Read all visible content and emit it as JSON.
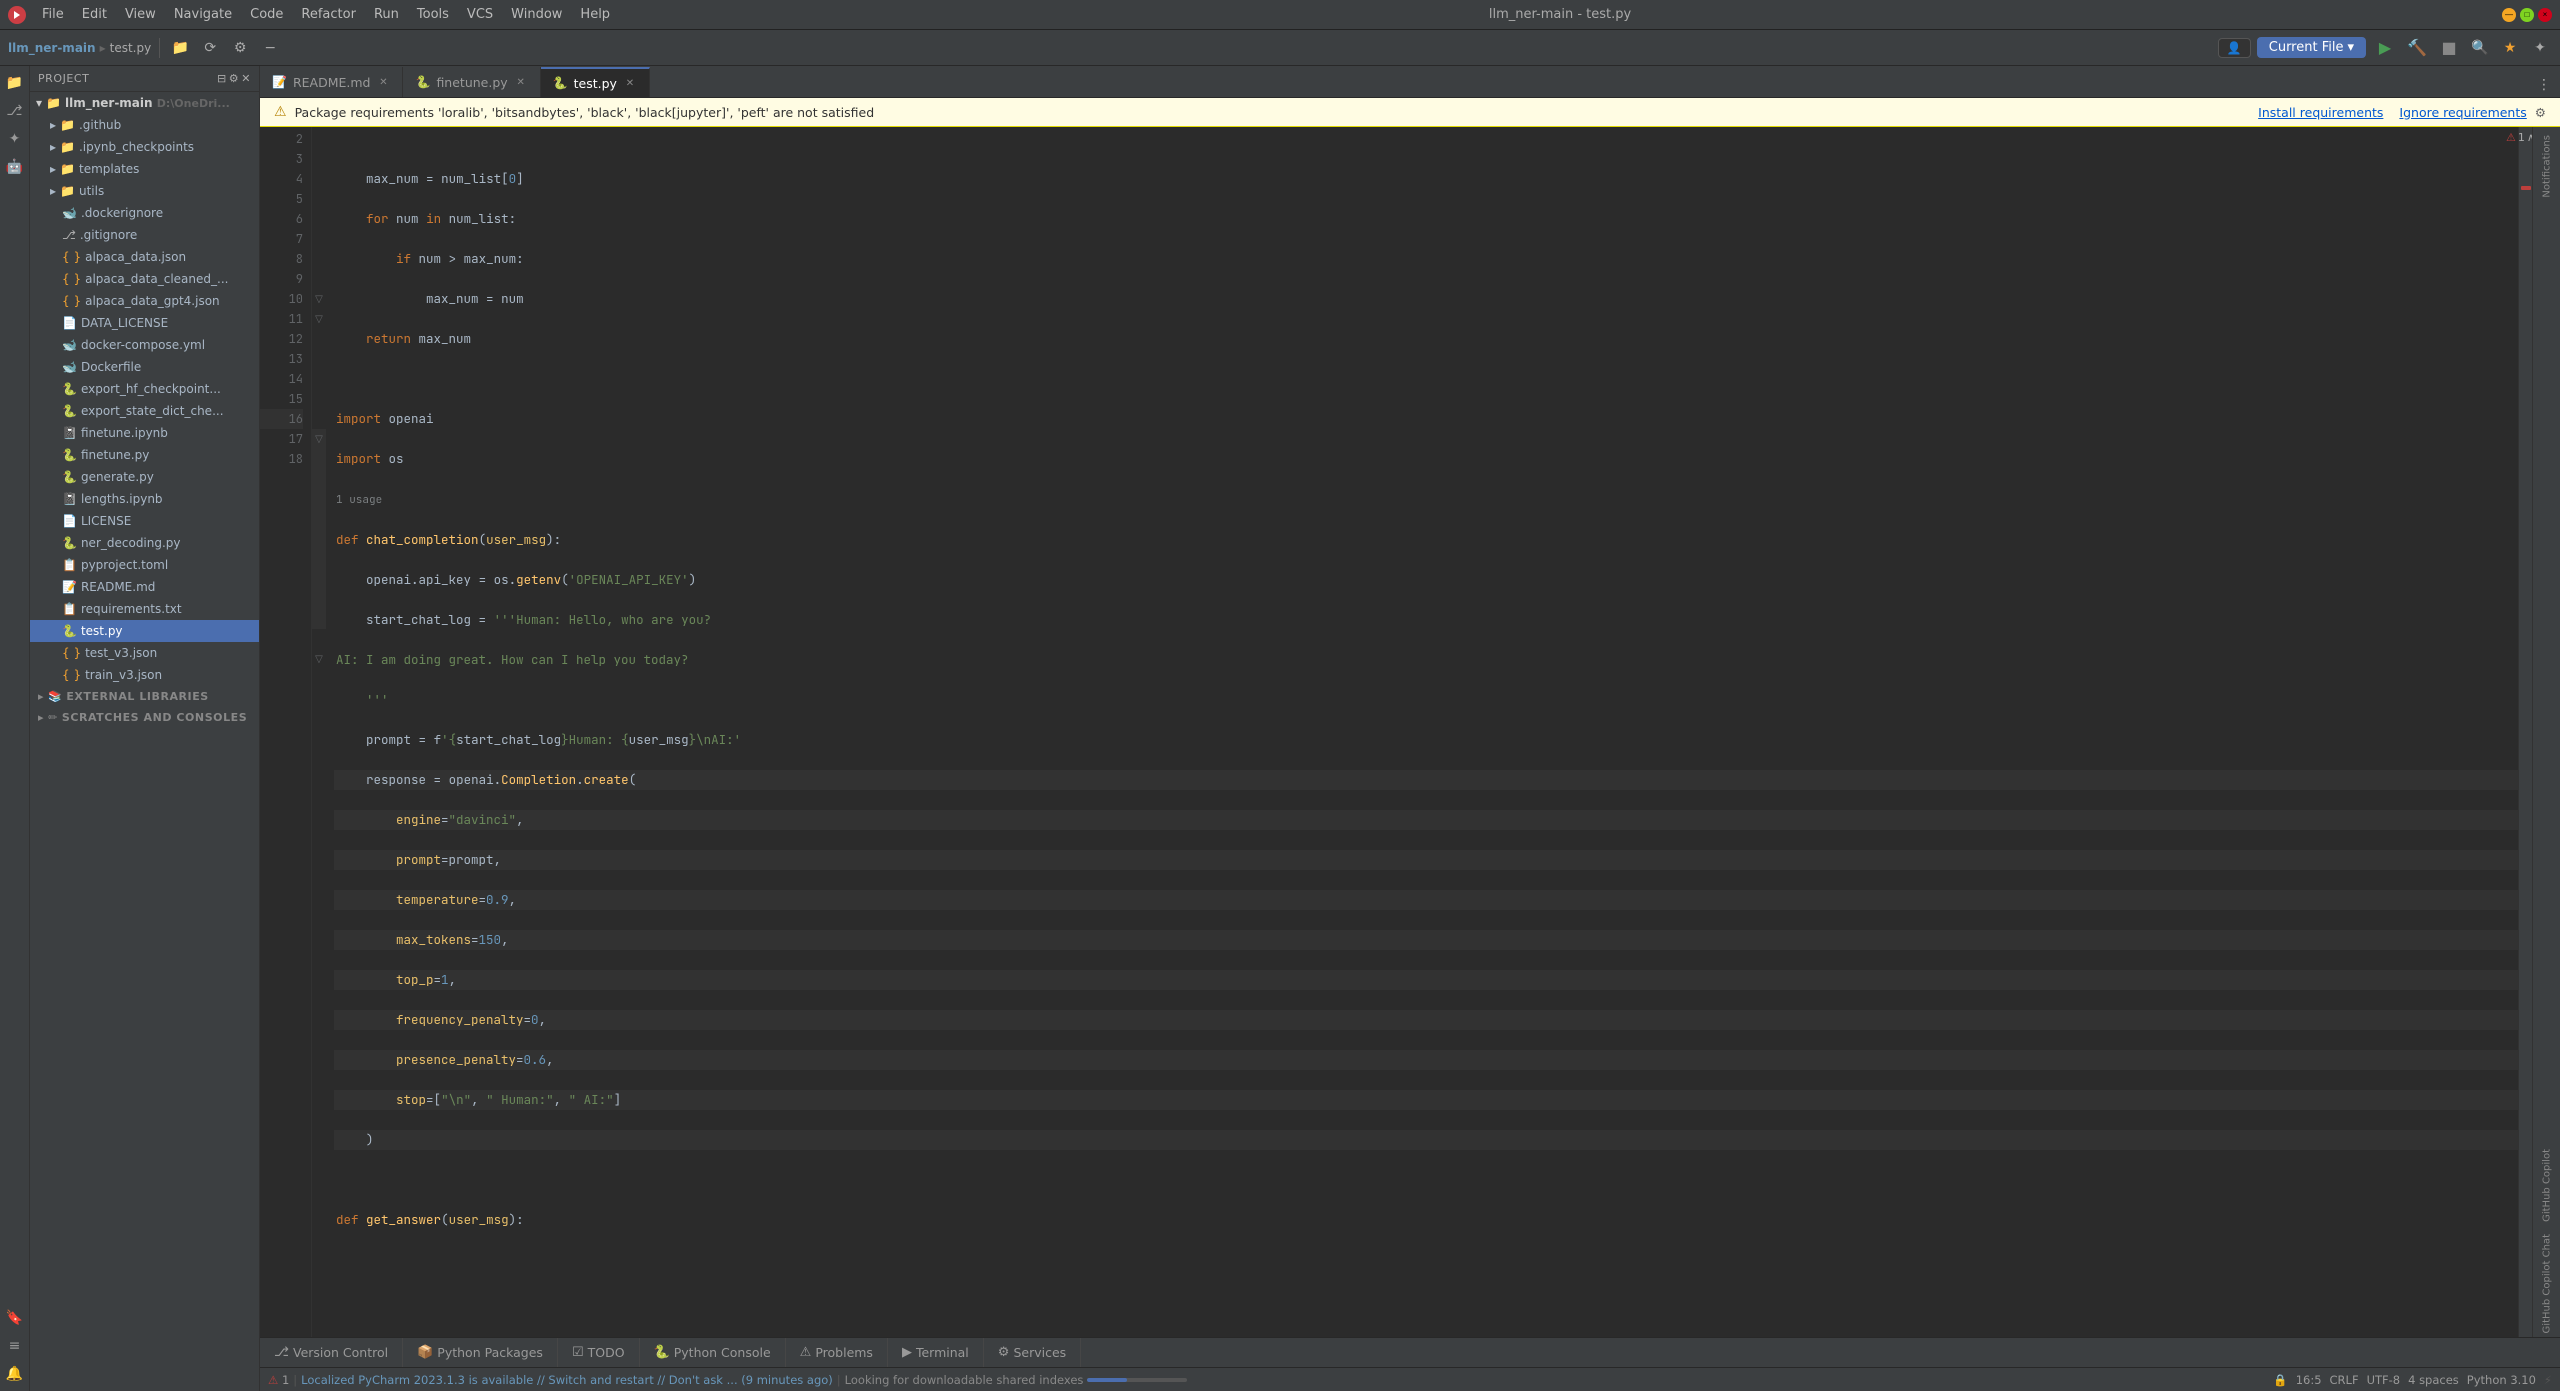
{
  "titlebar": {
    "logo": "P",
    "menus": [
      "File",
      "Edit",
      "View",
      "Navigate",
      "Code",
      "Refactor",
      "Run",
      "Tools",
      "VCS",
      "Window",
      "Help"
    ],
    "title": "llm_ner-main - test.py",
    "project_name": "llm_ner-main"
  },
  "toolbar": {
    "current_file_label": "Current File",
    "run_label": "▶",
    "stop_label": "■",
    "search_label": "🔍",
    "settings_label": "⚙"
  },
  "tabs": [
    {
      "id": "readme",
      "label": "README.md",
      "icon": "md",
      "active": false,
      "closeable": true
    },
    {
      "id": "finetune",
      "label": "finetune.py",
      "icon": "py",
      "active": false,
      "closeable": true
    },
    {
      "id": "test",
      "label": "test.py",
      "icon": "py",
      "active": true,
      "closeable": true
    }
  ],
  "warning_banner": {
    "text": "Package requirements 'loralib', 'bitsandbytes', 'black', 'black[jupyter]', 'peft' are not satisfied",
    "install_label": "Install requirements",
    "ignore_label": "Ignore requirements",
    "settings_icon": "⚙"
  },
  "breadcrumb": {
    "parts": [
      "test.py"
    ]
  },
  "editor": {
    "lines": [
      {
        "num": 2,
        "content": "    max_num = num_list[0]"
      },
      {
        "num": 3,
        "content": "    for num in num_list:"
      },
      {
        "num": 4,
        "content": "        if num > max_num:"
      },
      {
        "num": 5,
        "content": "            max_num = num"
      },
      {
        "num": 6,
        "content": "    return max_num"
      },
      {
        "num": 7,
        "content": ""
      },
      {
        "num": 8,
        "content": "import openai"
      },
      {
        "num": 9,
        "content": "import os"
      },
      {
        "num": 10,
        "content": "def chat_completion(user_msg):"
      },
      {
        "num": 11,
        "content": "    openai.api_key = os.getenv('OPENAI_API_KEY')"
      },
      {
        "num": 12,
        "content": "    start_chat_log = '''Human: Hello, who are you?"
      },
      {
        "num": 13,
        "content": "AI: I am doing great. How can I help you today?"
      },
      {
        "num": 14,
        "content": "    '''"
      },
      {
        "num": 15,
        "content": "    prompt = f'{start_chat_log}Human: {user_msg}\\nAI:'"
      },
      {
        "num": 16,
        "content": "    response = openai.Completion.create("
      },
      {
        "num": 16,
        "content": "        engine=\"davinci\","
      },
      {
        "num": 16,
        "content": "        prompt=prompt,"
      },
      {
        "num": 16,
        "content": "        temperature=0.9,"
      },
      {
        "num": 16,
        "content": "        max_tokens=150,"
      },
      {
        "num": 16,
        "content": "        top_p=1,"
      },
      {
        "num": 16,
        "content": "        frequency_penalty=0,"
      },
      {
        "num": 16,
        "content": "        presence_penalty=0.6,"
      },
      {
        "num": 16,
        "content": "        stop=[\"\\n\", \" Human:\", \" AI:\"]"
      },
      {
        "num": 16,
        "content": "    )"
      },
      {
        "num": 17,
        "content": ""
      },
      {
        "num": 18,
        "content": "def get_answer(user_msg):"
      }
    ],
    "usage_hint": "1 usage",
    "current_line": 16
  },
  "project": {
    "root_label": "llm_ner-main",
    "root_path": "D:\\OneDri...",
    "items": [
      {
        "id": "github",
        "label": ".github",
        "type": "folder",
        "depth": 1
      },
      {
        "id": "ipynb_checkpoints",
        "label": ".ipynb_checkpoints",
        "type": "folder",
        "depth": 1
      },
      {
        "id": "templates",
        "label": "templates",
        "type": "folder",
        "depth": 1
      },
      {
        "id": "utils",
        "label": "utils",
        "type": "folder",
        "depth": 1
      },
      {
        "id": "dockerignore",
        "label": ".dockerignore",
        "type": "file",
        "depth": 1
      },
      {
        "id": "gitignore",
        "label": ".gitignore",
        "type": "file",
        "depth": 1
      },
      {
        "id": "alpaca_data_json",
        "label": "alpaca_data.json",
        "type": "file-json",
        "depth": 1
      },
      {
        "id": "alpaca_data_cleaned",
        "label": "alpaca_data_cleaned_...",
        "type": "file-json",
        "depth": 1
      },
      {
        "id": "alpaca_data_gpt4",
        "label": "alpaca_data_gpt4.json",
        "type": "file-json",
        "depth": 1
      },
      {
        "id": "data_license",
        "label": "DATA_LICENSE",
        "type": "file",
        "depth": 1
      },
      {
        "id": "docker_compose",
        "label": "docker-compose.yml",
        "type": "file-yml",
        "depth": 1
      },
      {
        "id": "dockerfile",
        "label": "Dockerfile",
        "type": "file",
        "depth": 1
      },
      {
        "id": "export_hf",
        "label": "export_hf_checkpoint...",
        "type": "file-py",
        "depth": 1
      },
      {
        "id": "export_state",
        "label": "export_state_dict_che...",
        "type": "file-py",
        "depth": 1
      },
      {
        "id": "finetune_ipynb",
        "label": "finetune.ipynb",
        "type": "file-ipynb",
        "depth": 1
      },
      {
        "id": "finetune_py",
        "label": "finetune.py",
        "type": "file-py",
        "depth": 1
      },
      {
        "id": "generate_py",
        "label": "generate.py",
        "type": "file-py",
        "depth": 1
      },
      {
        "id": "lengths_ipynb",
        "label": "lengths.ipynb",
        "type": "file-ipynb",
        "depth": 1
      },
      {
        "id": "license",
        "label": "LICENSE",
        "type": "file",
        "depth": 1
      },
      {
        "id": "ner_decoding",
        "label": "ner_decoding.py",
        "type": "file-py",
        "depth": 1
      },
      {
        "id": "pyproject",
        "label": "pyproject.toml",
        "type": "file-toml",
        "depth": 1
      },
      {
        "id": "readme",
        "label": "README.md",
        "type": "file-md",
        "depth": 1
      },
      {
        "id": "requirements",
        "label": "requirements.txt",
        "type": "file-txt",
        "depth": 1
      },
      {
        "id": "test_py",
        "label": "test.py",
        "type": "file-py",
        "depth": 1,
        "selected": true
      },
      {
        "id": "test_v3_json",
        "label": "test_v3.json",
        "type": "file-json",
        "depth": 1
      },
      {
        "id": "train_v3_json",
        "label": "train_v3.json",
        "type": "file-json",
        "depth": 1
      }
    ],
    "sections": [
      {
        "id": "external-libraries",
        "label": "External Libraries"
      },
      {
        "id": "scratches",
        "label": "Scratches and Consoles"
      }
    ]
  },
  "bottom_tabs": [
    {
      "id": "version-control",
      "label": "Version Control",
      "icon": "⎇"
    },
    {
      "id": "python-packages",
      "label": "Python Packages",
      "icon": "📦"
    },
    {
      "id": "todo",
      "label": "TODO",
      "icon": "☑"
    },
    {
      "id": "python-console",
      "label": "Python Console",
      "icon": "🐍"
    },
    {
      "id": "problems",
      "label": "Problems",
      "icon": "⚠"
    },
    {
      "id": "terminal",
      "label": "Terminal",
      "icon": ">"
    },
    {
      "id": "services",
      "label": "Services",
      "icon": "⚙"
    }
  ],
  "status_bar": {
    "warning_icon": "⚠",
    "warning_count": "1",
    "notification_text": "Localized PyCharm 2023.1.3 is available // Switch and restart // Don't ask ... (9 minutes ago)",
    "indexing_text": "Looking for downloadable shared indexes",
    "position": "16:5",
    "line_ending": "CRLF",
    "encoding": "UTF-8",
    "indent": "4 spaces",
    "python_version": "Python 3.10",
    "lock_icon": "🔒"
  },
  "colors": {
    "accent": "#4b6eaf",
    "background": "#2b2b2b",
    "panel_bg": "#3c3f41",
    "border": "#323232",
    "warning_bg": "#fffce3",
    "error_red": "#bc3f3c",
    "green": "#499c54"
  }
}
